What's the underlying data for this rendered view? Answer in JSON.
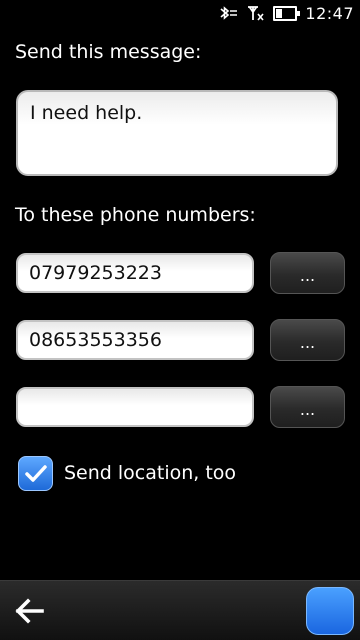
{
  "status_bar": {
    "bluetooth_icon": "bluetooth-icon",
    "signal_icon": "no-signal-icon",
    "battery_icon": "battery-icon",
    "time": "12:47"
  },
  "message": {
    "label": "Send this message:",
    "value": "I need help."
  },
  "recipients": {
    "label": "To these phone numbers:",
    "numbers": [
      "07979253223",
      "08653553356",
      ""
    ],
    "picker_label": "..."
  },
  "location": {
    "label": "Send location, too",
    "checked": true
  },
  "toolbar": {
    "back_icon": "back-arrow-icon",
    "action_icon": "action-button"
  },
  "colors": {
    "accent": "#2f86f0",
    "background": "#000000"
  }
}
